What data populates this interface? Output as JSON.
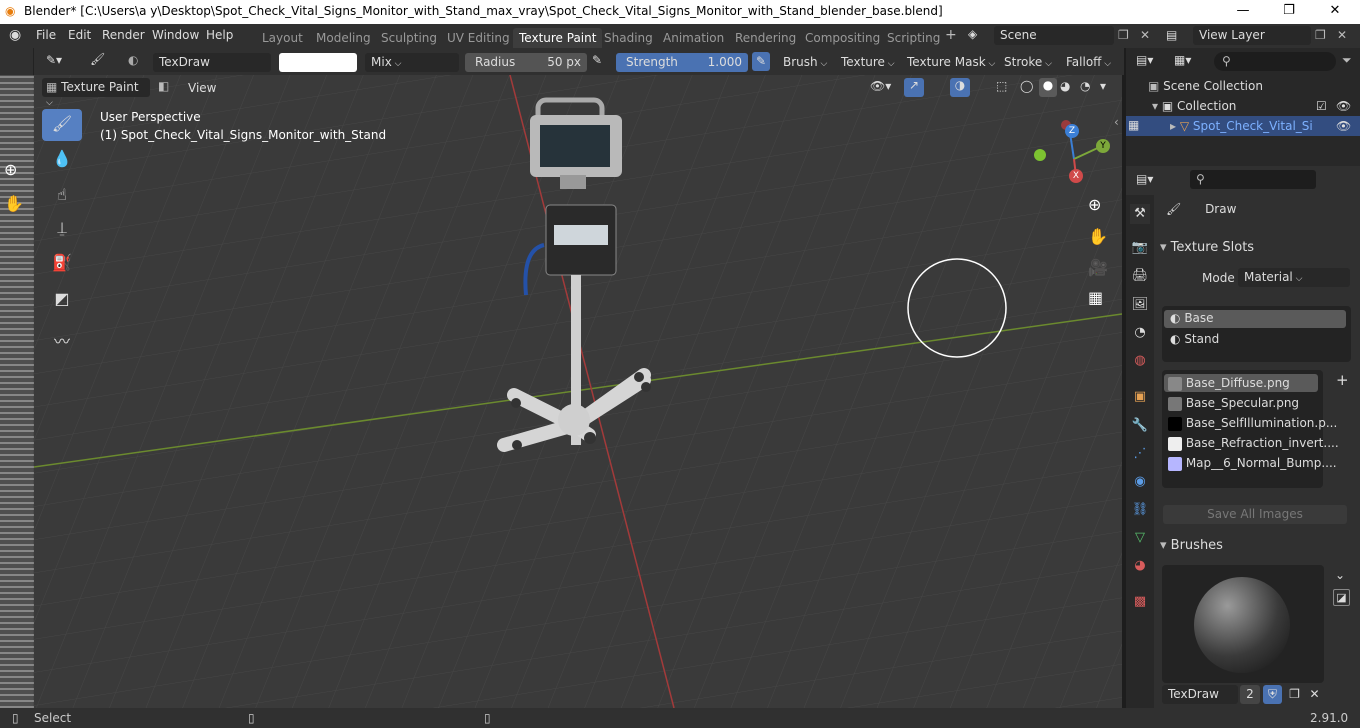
{
  "titlebar": {
    "title": "Blender* [C:\\Users\\a y\\Desktop\\Spot_Check_Vital_Signs_Monitor_with_Stand_max_vray\\Spot_Check_Vital_Signs_Monitor_with_Stand_blender_base.blend]",
    "minimize": "—",
    "maximize": "❐",
    "close": "✕"
  },
  "menus": [
    "File",
    "Edit",
    "Render",
    "Window",
    "Help"
  ],
  "workspaces": [
    "Layout",
    "Modeling",
    "Sculpting",
    "UV Editing",
    "Texture Paint",
    "Shading",
    "Animation",
    "Rendering",
    "Compositing",
    "Scripting"
  ],
  "active_workspace": "Texture Paint",
  "scene": "Scene",
  "view_layer": "View Layer",
  "toolsettings": {
    "brush_name": "TexDraw",
    "blend": "Mix",
    "radius_label": "Radius",
    "radius_value": "50 px",
    "strength_label": "Strength",
    "strength_value": "1.000",
    "brush_menu": "Brush",
    "texture_menu": "Texture",
    "texture_mask_menu": "Texture Mask",
    "stroke_menu": "Stroke",
    "falloff_menu": "Falloff"
  },
  "mode": "Texture Paint",
  "view_menu": "View",
  "viewport_text": {
    "line1": "User Perspective",
    "line2": "(1) Spot_Check_Vital_Signs_Monitor_with_Stand"
  },
  "gizmo": {
    "x": "X",
    "y": "Y",
    "z": "Z"
  },
  "outliner": {
    "scene_collection": "Scene Collection",
    "collection": "Collection",
    "object": "Spot_Check_Vital_Si"
  },
  "properties": {
    "tool_name": "Draw",
    "texture_slots_header": "Texture Slots",
    "mode_label": "Mode",
    "mode_value": "Material",
    "materials": [
      "Base",
      "Stand"
    ],
    "images": [
      "Base_Diffuse.png",
      "Base_Specular.png",
      "Base_SelfIllumination.p...",
      "Base_Refraction_invert....",
      "Map__6_Normal_Bump...."
    ],
    "save_all": "Save All Images",
    "brushes_header": "Brushes",
    "brush_name": "TexDraw",
    "brush_users": "2"
  },
  "status": {
    "select": "Select",
    "version": "2.91.0"
  },
  "colors": {
    "active_blue": "#5680c2",
    "x_axis": "#d04a4a",
    "y_axis": "#7da83a",
    "z_axis": "#3b7fd6"
  }
}
